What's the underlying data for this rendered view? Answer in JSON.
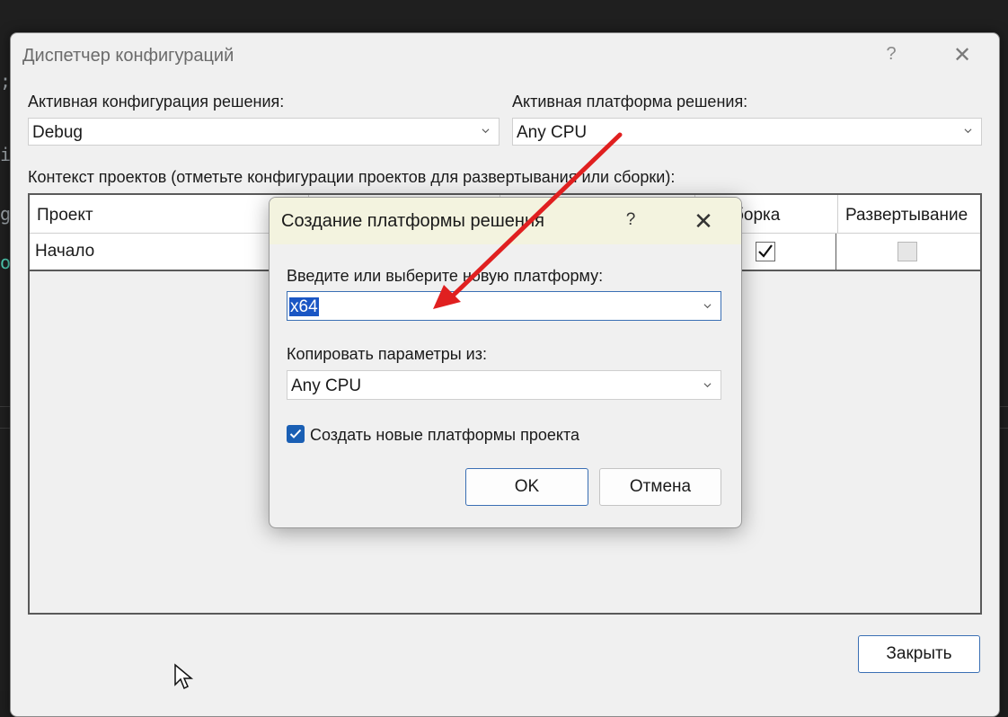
{
  "background": {
    "fragments": [
      ";",
      "i",
      "g",
      "o"
    ]
  },
  "config_manager": {
    "title": "Диспетчер конфигураций",
    "help": "?",
    "close": "✕",
    "active_config_label": "Активная конфигурация решения:",
    "active_config_value": "Debug",
    "active_platform_label": "Активная платформа решения:",
    "active_platform_value": "Any CPU",
    "projects_context_label": "Контекст проектов (отметьте конфигурации проектов для развертывания или сборки):",
    "columns": [
      "Проект",
      "",
      "",
      "борка",
      "Развертывание"
    ],
    "rows": [
      {
        "project": "Начало",
        "build": true,
        "deploy": false
      }
    ],
    "close_button": "Закрыть"
  },
  "new_platform_dialog": {
    "title": "Создание платформы решения",
    "help": "?",
    "close": "✕",
    "platform_label": "Введите или выберите новую платформу:",
    "platform_value": "x64",
    "copy_from_label": "Копировать параметры из:",
    "copy_from_value": "Any CPU",
    "create_project_platforms_label": "Создать новые платформы проекта",
    "create_project_platforms_checked": true,
    "ok": "OK",
    "cancel": "Отмена"
  },
  "colors": {
    "accent": "#1a5fb4",
    "annotation_arrow": "#e02020"
  }
}
